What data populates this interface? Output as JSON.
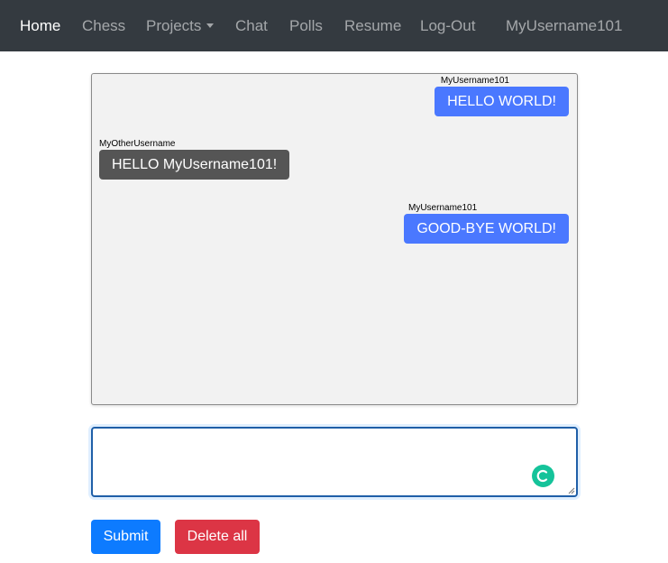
{
  "navbar": {
    "home": "Home",
    "chess": "Chess",
    "projects": "Projects",
    "chat": "Chat",
    "polls": "Polls",
    "resume": "Resume",
    "logout": "Log-Out",
    "username": "MyUsername101"
  },
  "messages": [
    {
      "user": "MyUsername101",
      "text": "HELLO WORLD!",
      "side": "right"
    },
    {
      "user": "MyOtherUsername",
      "text": "HELLO MyUsername101!",
      "side": "left"
    },
    {
      "user": "MyUsername101",
      "text": "GOOD-BYE WORLD!",
      "side": "right"
    }
  ],
  "composer": {
    "value": "",
    "placeholder": ""
  },
  "buttons": {
    "submit": "Submit",
    "delete_all": "Delete all"
  },
  "colors": {
    "navbar_bg": "#343a40",
    "own_bubble": "#4a78ff",
    "other_bubble": "#555555",
    "submit": "#0d7bff",
    "delete": "#dc3545",
    "grammar_icon": "#15c39a"
  },
  "icons": {
    "projects_dropdown": "caret-down-icon",
    "composer_widget": "grammarly-icon",
    "composer_resize": "resize-handle-icon"
  }
}
